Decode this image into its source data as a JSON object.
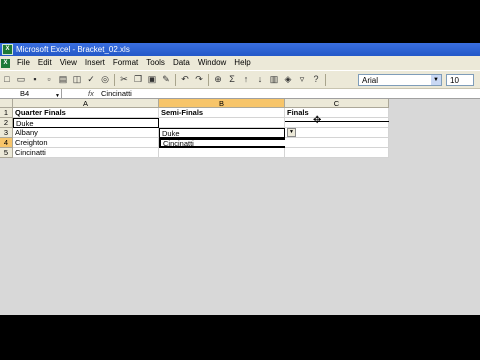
{
  "window": {
    "title": "Microsoft Excel - Bracket_02.xls"
  },
  "menu": [
    "File",
    "Edit",
    "View",
    "Insert",
    "Format",
    "Tools",
    "Data",
    "Window",
    "Help"
  ],
  "toolbar": {
    "font": "Arial",
    "font_size": "10"
  },
  "formula_bar": {
    "name_box": "B4",
    "fx": "fx",
    "value": "Cincinatti"
  },
  "columns": [
    "A",
    "B",
    "C"
  ],
  "rows": [
    "1",
    "2",
    "3",
    "4",
    "5"
  ],
  "cells": {
    "A1": "Quarter Finals",
    "B1": "Semi-Finals",
    "C1": "Finals",
    "A2": "Duke",
    "A3": "Albany",
    "B3": "Duke",
    "A4": "Creighton",
    "B4": "Cincinatti",
    "A5": "Cincinatti"
  },
  "selected_cell": "B4"
}
